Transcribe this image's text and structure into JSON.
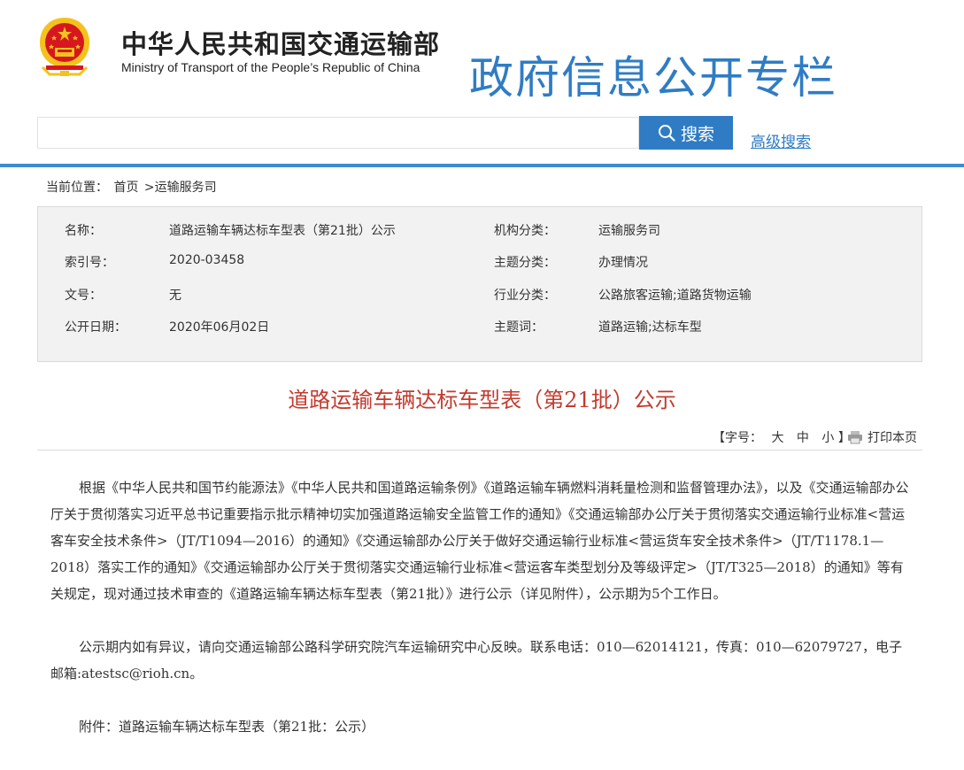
{
  "top": {
    "left_text": "",
    "right_text": ""
  },
  "header": {
    "cn_title": "中华人民共和国交通运输部",
    "en_title": "Ministry of Transport of the People’s Republic of China",
    "banner": "政府信息公开专栏"
  },
  "search": {
    "placeholder": "",
    "button_label": "搜索",
    "advanced_label": "高级搜索"
  },
  "breadcrumb": {
    "label": "当前位置：",
    "home": "首页",
    "section": ">运输服务司"
  },
  "meta": {
    "name_label": "名称：",
    "name_value": "道路运输车辆达标车型表（第21批）公示",
    "index_label": "索引号：",
    "index_value": "2020-03458",
    "doc_label": "文号：",
    "doc_value": "无",
    "date_label": "公开日期：",
    "date_value": "2020年06月02日",
    "org_label": "机构分类：",
    "org_value": "运输服务司",
    "topic_label": "主题分类：",
    "topic_value": "办理情况",
    "industry_label": "行业分类：",
    "industry_value": "公路旅客运输;道路货物运输",
    "keyword_label": "主题词：",
    "keyword_value": "道路运输;达标车型"
  },
  "article": {
    "title": "道路运输车辆达标车型表（第21批）公示",
    "font_label": "【字号：",
    "font_large": "大",
    "font_medium": "中",
    "font_small": "小",
    "font_close": "】",
    "print_label": "打印本页",
    "p1": "根据《中华人民共和国节约能源法》《中华人民共和国道路运输条例》《道路运输车辆燃料消耗量检测和监督管理办法》，以及《交通运输部办公厅关于贯彻落实习近平总书记重要指示批示精神切实加强道路运输安全监管工作的通知》《交通运输部办公厅关于贯彻落实交通运输行业标准<营运客车安全技术条件>（JT/T1094—2016）的通知》《交通运输部办公厅关于做好交通运输行业标准<营运货车安全技术条件>（JT/T1178.1—2018）落实工作的通知》《交通运输部办公厅关于贯彻落实交通运输行业标准<营运客车类型划分及等级评定>（JT/T325—2018）的通知》等有关规定，现对通过技术审查的《道路运输车辆达标车型表（第21批）》进行公示（详见附件），公示期为5个工作日。",
    "p2": "公示期内如有异议，请向交通运输部公路科学研究院汽车运输研究中心反映。联系电话：010—62014121，传真：010—62079727，电子邮箱:atestsc@rioh.cn。",
    "p3": "附件：道路运输车辆达标车型表（第21批：公示）"
  },
  "colors": {
    "accent": "#2f7cc4",
    "title_red": "#c33a2e",
    "emblem_red": "#d7171f",
    "emblem_gold": "#f4c21d"
  },
  "icons": {
    "emblem": "national-emblem-icon",
    "search": "search-icon",
    "print": "printer-icon"
  }
}
